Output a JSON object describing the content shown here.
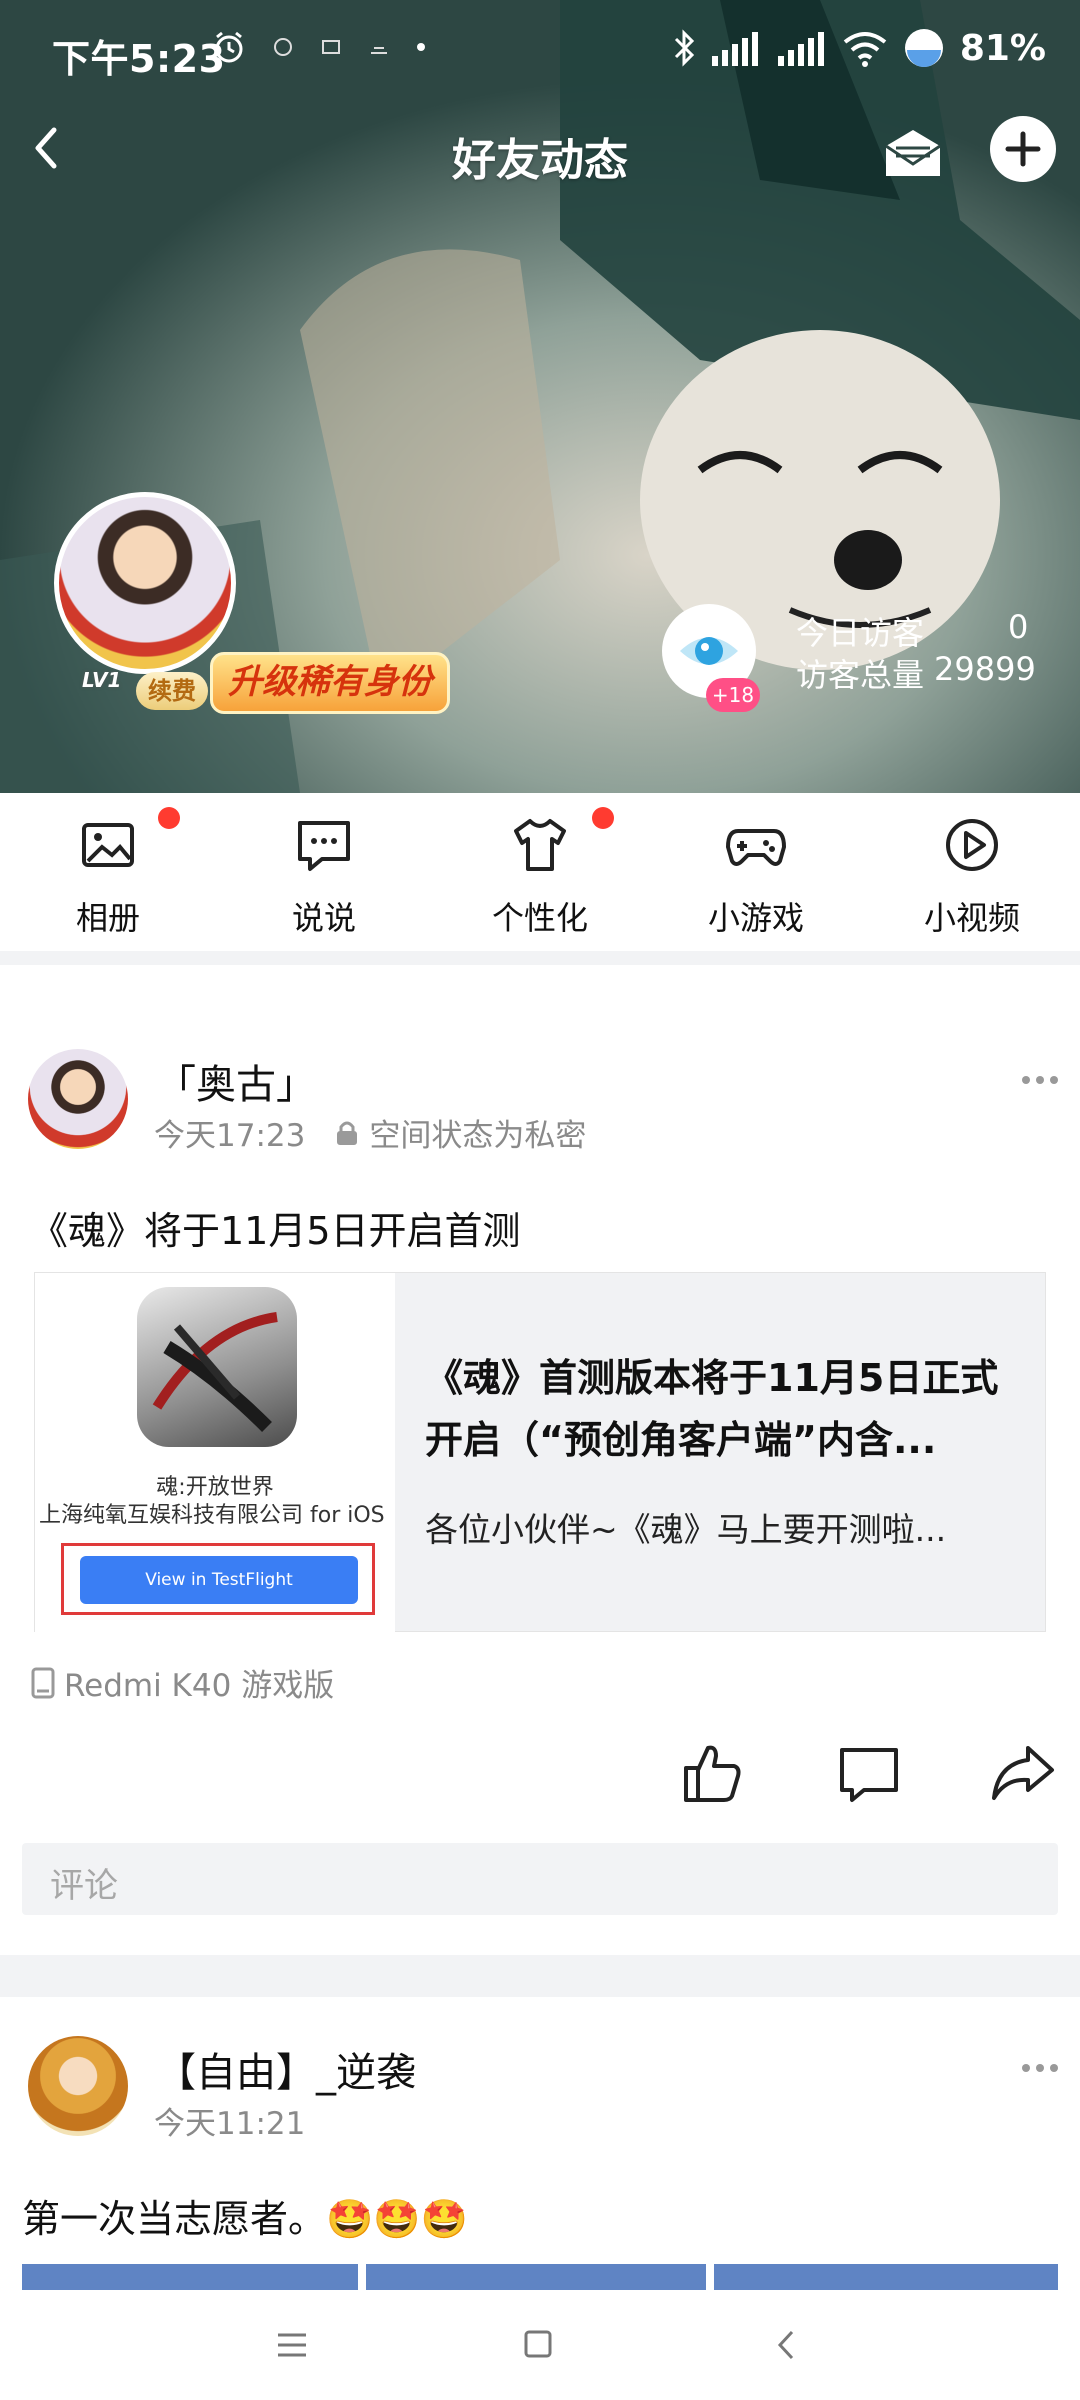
{
  "status_bar": {
    "time": "下午5:23",
    "battery": "81%"
  },
  "header": {
    "title": "好友动态"
  },
  "profile": {
    "level": "LV1",
    "renew_label": "续费",
    "upgrade_label": "升级稀有身份",
    "eye_badge": "+18",
    "visitors_today_label": "今日访客",
    "visitors_today_value": "0",
    "visitors_total_label": "访客总量",
    "visitors_total_value": "29899"
  },
  "shortcuts": [
    {
      "label": "相册",
      "icon": "album-icon",
      "has_dot": true
    },
    {
      "label": "说说",
      "icon": "chat-icon",
      "has_dot": false
    },
    {
      "label": "个性化",
      "icon": "tshirt-icon",
      "has_dot": true
    },
    {
      "label": "小游戏",
      "icon": "gamepad-icon",
      "has_dot": false
    },
    {
      "label": "小视频",
      "icon": "video-icon",
      "has_dot": false
    }
  ],
  "posts": [
    {
      "author": "「奥古」",
      "time": "今天17:23",
      "privacy": "空间状态为私密",
      "text": "《魂》将于11月5日开启首测",
      "share": {
        "thumb_app_name": "魂:开放世界",
        "thumb_company": "上海纯氧互娱科技有限公司 for iOS",
        "thumb_button": "View in TestFlight",
        "title": "《魂》首测版本将于11月5日正式开启（“预创角客户端”内含...",
        "desc": "各位小伙伴~《魂》马上要开测啦..."
      },
      "device": "Redmi K40 游戏版",
      "comment_placeholder": "评论"
    },
    {
      "author": "【自由】_逆袭",
      "time": "今天11:21",
      "text": "第一次当志愿者。🤩🤩🤩"
    }
  ],
  "colors": {
    "accent_blue": "#3a7ef4",
    "red_dot": "#ff3b30",
    "badge_pink": "#ff4f86",
    "separator": "#f2f3f5"
  }
}
